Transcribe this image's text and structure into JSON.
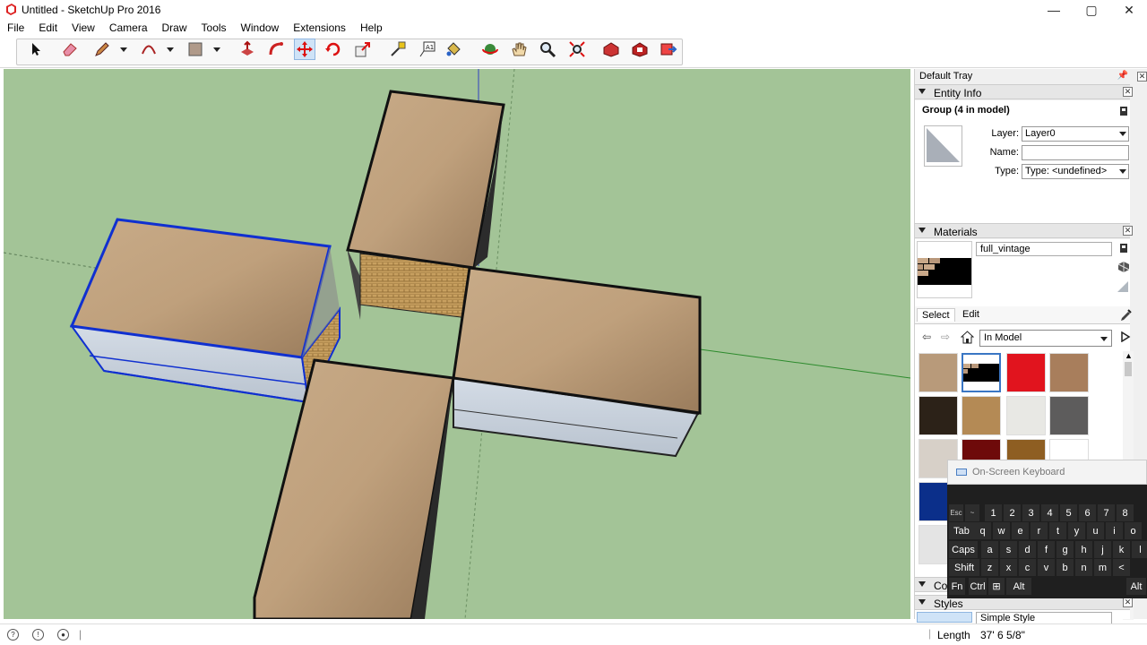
{
  "window": {
    "title": "Untitled - SketchUp Pro 2016",
    "minimize": "—",
    "maximize": "▢",
    "close": "✕"
  },
  "menu": [
    "File",
    "Edit",
    "View",
    "Camera",
    "Draw",
    "Tools",
    "Window",
    "Extensions",
    "Help"
  ],
  "toolbar": {
    "tools": [
      "select",
      "eraser",
      "line",
      "arc",
      "rectangle",
      "push-pull",
      "follow-me",
      "move",
      "rotate",
      "scale",
      "tape-measure",
      "text",
      "paint-bucket",
      "orbit",
      "pan",
      "zoom",
      "zoom-extents",
      "warehouse",
      "extension-warehouse",
      "send-to-layout"
    ],
    "active_tool": "move"
  },
  "tray": {
    "title": "Default Tray",
    "entity_info": {
      "heading": "Entity Info",
      "selection": "Group (4 in model)",
      "layer_label": "Layer:",
      "layer_value": "Layer0",
      "name_label": "Name:",
      "name_value": "",
      "type_label": "Type:",
      "type_value": "Type: <undefined>"
    },
    "materials": {
      "heading": "Materials",
      "current_name": "full_vintage",
      "tab_select": "Select",
      "tab_edit": "Edit",
      "collection": "In Model",
      "swatch_colors": [
        "#b89a7a",
        "#111111",
        "#e1141e",
        "#a87e5c",
        "#2c2218",
        "#b48a55",
        "#e8e8e4",
        "#5d5c5c",
        "#d7d0c8",
        "#6e0a0a",
        "#8e5e22",
        "#ffffff",
        "#0b2f8a"
      ]
    },
    "styles": {
      "heading": "Styles",
      "current_name": "Simple Style"
    },
    "components_heading": "Co"
  },
  "osk": {
    "title": "On-Screen Keyboard",
    "row1": [
      "Esc",
      "~",
      "!",
      "@",
      "#",
      "$",
      "%",
      "^",
      "&"
    ],
    "row1_digits": [
      "1",
      "2",
      "3",
      "4",
      "5",
      "6",
      "7",
      "8"
    ],
    "row2": [
      "Tab",
      "q",
      "w",
      "e",
      "r",
      "t",
      "y",
      "u",
      "i",
      "o"
    ],
    "row3": [
      "Caps",
      "a",
      "s",
      "d",
      "f",
      "g",
      "h",
      "j",
      "k",
      "l"
    ],
    "row4": [
      "Shift",
      "z",
      "x",
      "c",
      "v",
      "b",
      "n",
      "m",
      "<"
    ],
    "row5": [
      "Fn",
      "Ctrl",
      "⊞",
      "Alt",
      "Alt"
    ]
  },
  "status": {
    "length_label": "Length",
    "length_value": "37' 6 5/8\""
  }
}
